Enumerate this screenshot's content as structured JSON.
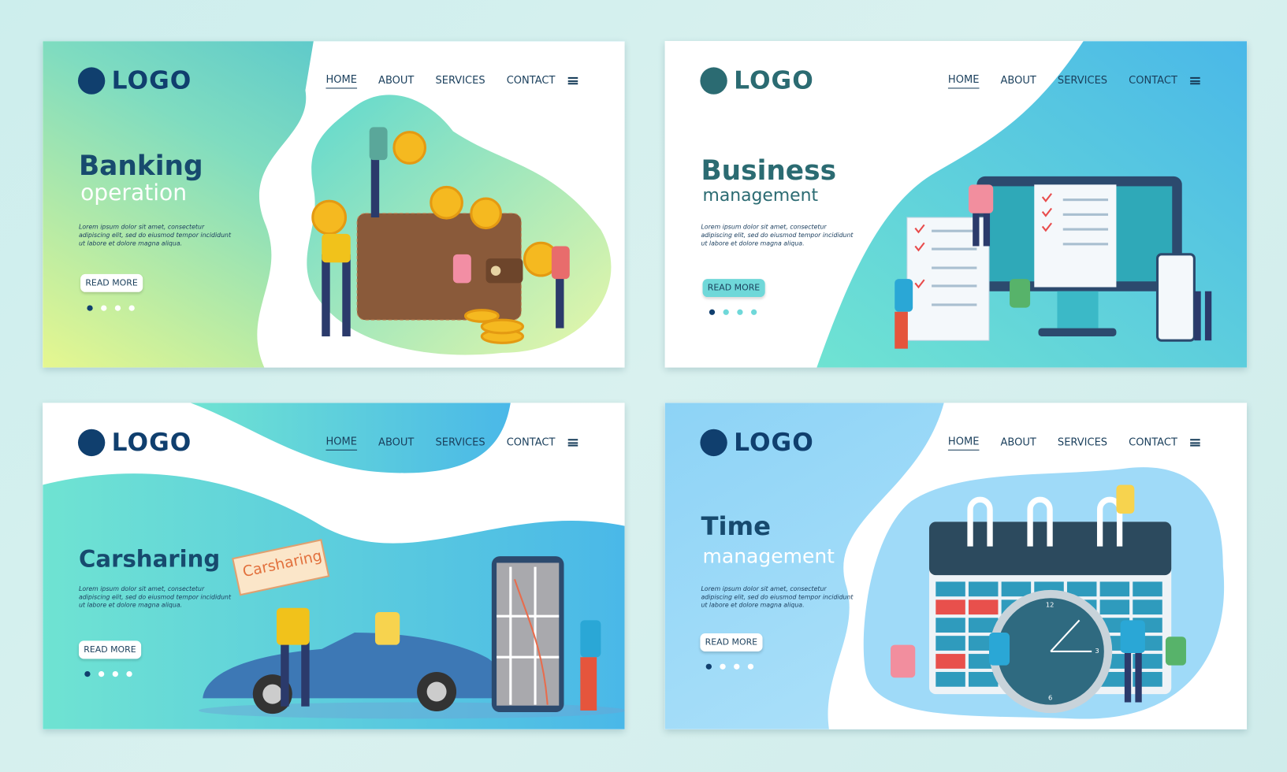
{
  "cards": [
    {
      "logo": "LOGO",
      "nav": [
        "HOME",
        "ABOUT",
        "SERVICES",
        "CONTACT"
      ],
      "title": "Banking",
      "subtitle": "operation",
      "lorem": "Lorem ipsum dolor sit amet, consectetur adipiscing elit, sed do eiusmod tempor incididunt ut labore et dolore magna aliqua.",
      "button": "READ MORE",
      "slides": 4,
      "active_slide": 1,
      "illustration": "wallet-with-coins"
    },
    {
      "logo": "LOGO",
      "nav": [
        "HOME",
        "ABOUT",
        "SERVICES",
        "CONTACT"
      ],
      "title": "Business",
      "subtitle": "management",
      "lorem": "Lorem ipsum dolor sit amet, consectetur adipiscing elit, sed do eiusmod tempor incididunt ut labore et dolore magna aliqua.",
      "button": "READ MORE",
      "slides": 4,
      "active_slide": 1,
      "illustration": "monitor-checklists"
    },
    {
      "logo": "LOGO",
      "nav": [
        "HOME",
        "ABOUT",
        "SERVICES",
        "CONTACT"
      ],
      "title": "Carsharing",
      "subtitle": "",
      "lorem": "Lorem ipsum dolor sit amet, consectetur adipiscing elit, sed do eiusmod tempor incididunt ut labore et dolore magna aliqua.",
      "button": "READ MORE",
      "slides": 4,
      "active_slide": 1,
      "sign": "Carsharing",
      "illustration": "car-and-phone-map"
    },
    {
      "logo": "LOGO",
      "nav": [
        "HOME",
        "ABOUT",
        "SERVICES",
        "CONTACT"
      ],
      "title": "Time",
      "subtitle": "management",
      "lorem": "Lorem ipsum dolor sit amet, consectetur adipiscing elit, sed do eiusmod tempor incididunt ut labore et dolore magna aliqua.",
      "button": "READ MORE",
      "slides": 4,
      "active_slide": 1,
      "clock": [
        "12",
        "3",
        "6"
      ],
      "illustration": "calendar-and-clock"
    }
  ],
  "colors": {
    "brand": "#103f6e",
    "teal": "#4fd1c5",
    "blue": "#4ab8e8"
  }
}
